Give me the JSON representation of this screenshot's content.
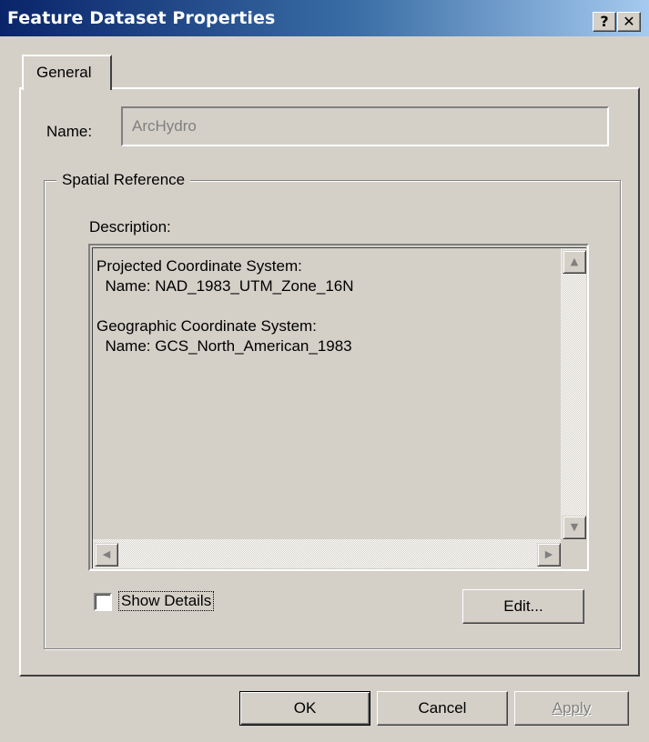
{
  "window": {
    "title": "Feature Dataset Properties",
    "help_button": "?",
    "close_button": "✕"
  },
  "tabs": [
    {
      "label": "General",
      "selected": true
    }
  ],
  "name_field": {
    "label": "Name:",
    "value": "ArcHydro",
    "disabled": true
  },
  "spatial_reference": {
    "group_label": "Spatial Reference",
    "description_label": "Description:",
    "description_lines": [
      "Projected Coordinate System:",
      "  Name: NAD_1983_UTM_Zone_16N",
      "",
      "Geographic Coordinate System:",
      "  Name: GCS_North_American_1983"
    ],
    "show_details_label": "Show Details",
    "show_details_checked": false,
    "edit_button": "Edit..."
  },
  "footer": {
    "ok": "OK",
    "cancel": "Cancel",
    "apply": "Apply",
    "apply_enabled": false
  },
  "colors": {
    "face": "#d4d0c8",
    "titlebar_start": "#0a246a",
    "titlebar_end": "#a6caf0"
  }
}
